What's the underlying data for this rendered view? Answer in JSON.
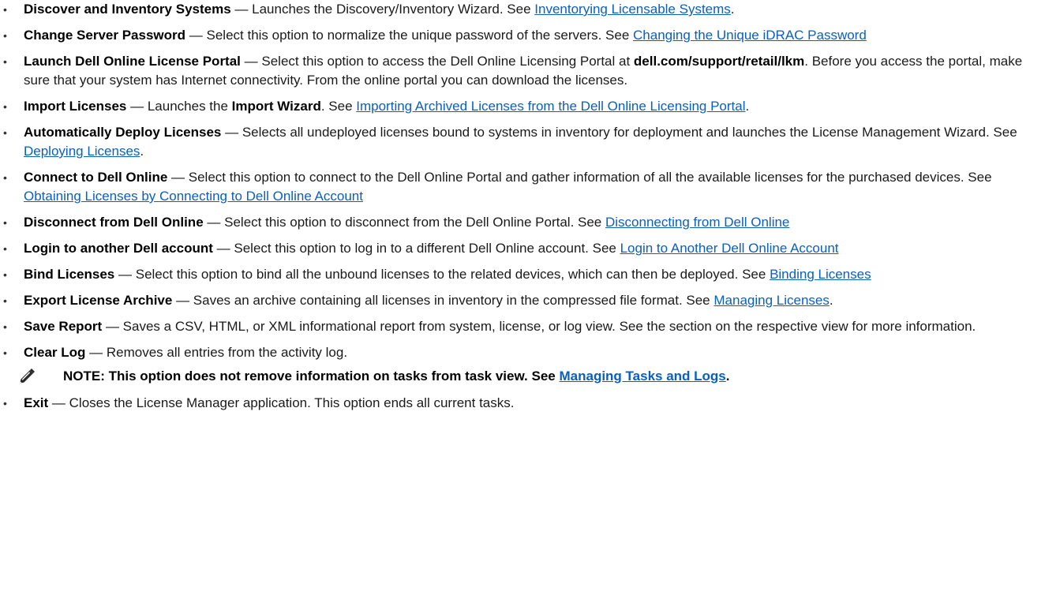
{
  "colors": {
    "link": "#0b5fbd",
    "text": "#1a1a1a",
    "bullet": "#333333"
  },
  "bullet_glyph": "•",
  "dash": "—",
  "items": [
    {
      "term": "Discover and Inventory Systems",
      "text": "Launches the Discovery/Inventory Wizard. See ",
      "link": "Inventorying Licensable Systems",
      "after": "."
    },
    {
      "term": "Change Server Password",
      "text": "Select this option to normalize the unique password of the servers. See ",
      "link": "Changing the Unique iDRAC Password",
      "after": ""
    },
    {
      "term": "Launch Dell Online License Portal",
      "text": "Select this option to access the Dell Online Licensing Portal at ",
      "bold": "dell.com/support/retail/lkm",
      "text2": ". Before you access the portal, make sure that your system has Internet connectivity. From the online portal you can download the licenses."
    },
    {
      "term": "Import Licenses",
      "text": "Launches the ",
      "bold": "Import Wizard",
      "text2": ". See ",
      "link": "Importing Archived Licenses from the Dell Online Licensing Portal",
      "after": "."
    },
    {
      "term": "Automatically Deploy Licenses",
      "text": "Selects all undeployed licenses bound to systems in inventory for deployment and launches the License Management Wizard. See ",
      "link": "Deploying Licenses",
      "after": "."
    },
    {
      "term": "Connect to Dell Online",
      "text": "Select this option to connect to the Dell Online Portal and gather information of all the available licenses for the purchased devices. See ",
      "link": "Obtaining Licenses by Connecting to Dell Online Account",
      "after": ""
    },
    {
      "term": "Disconnect from Dell Online",
      "text": "Select this option to disconnect from the Dell Online Portal. See ",
      "link": "Disconnecting from Dell Online",
      "after": ""
    },
    {
      "term": "Login to another Dell account",
      "text": "Select this option to log in to a different Dell Online account. See ",
      "link": "Login to Another Dell Online Account",
      "after": ""
    },
    {
      "term": "Bind Licenses",
      "text": "Select this option to bind all the unbound licenses to the related devices, which can then be deployed. See ",
      "link": "Binding Licenses",
      "after": ""
    },
    {
      "term": "Export License Archive",
      "text": "Saves an archive containing all licenses in inventory in the compressed file format. See ",
      "link": "Managing Licenses",
      "after": "."
    },
    {
      "term": "Save Report",
      "text": "Saves a CSV, HTML, or XML informational report from system, license, or log view. See the section on the respective view for more information."
    },
    {
      "term": "Clear Log",
      "text": "Removes all entries from the activity log."
    }
  ],
  "note": {
    "icon": "pencil-note-icon",
    "text": "NOTE: This option does not remove information on tasks from task view. See ",
    "link": "Managing Tasks and Logs",
    "after": "."
  },
  "exit_item": {
    "term": "Exit",
    "text": "Closes the License Manager application. This option ends all current tasks."
  }
}
